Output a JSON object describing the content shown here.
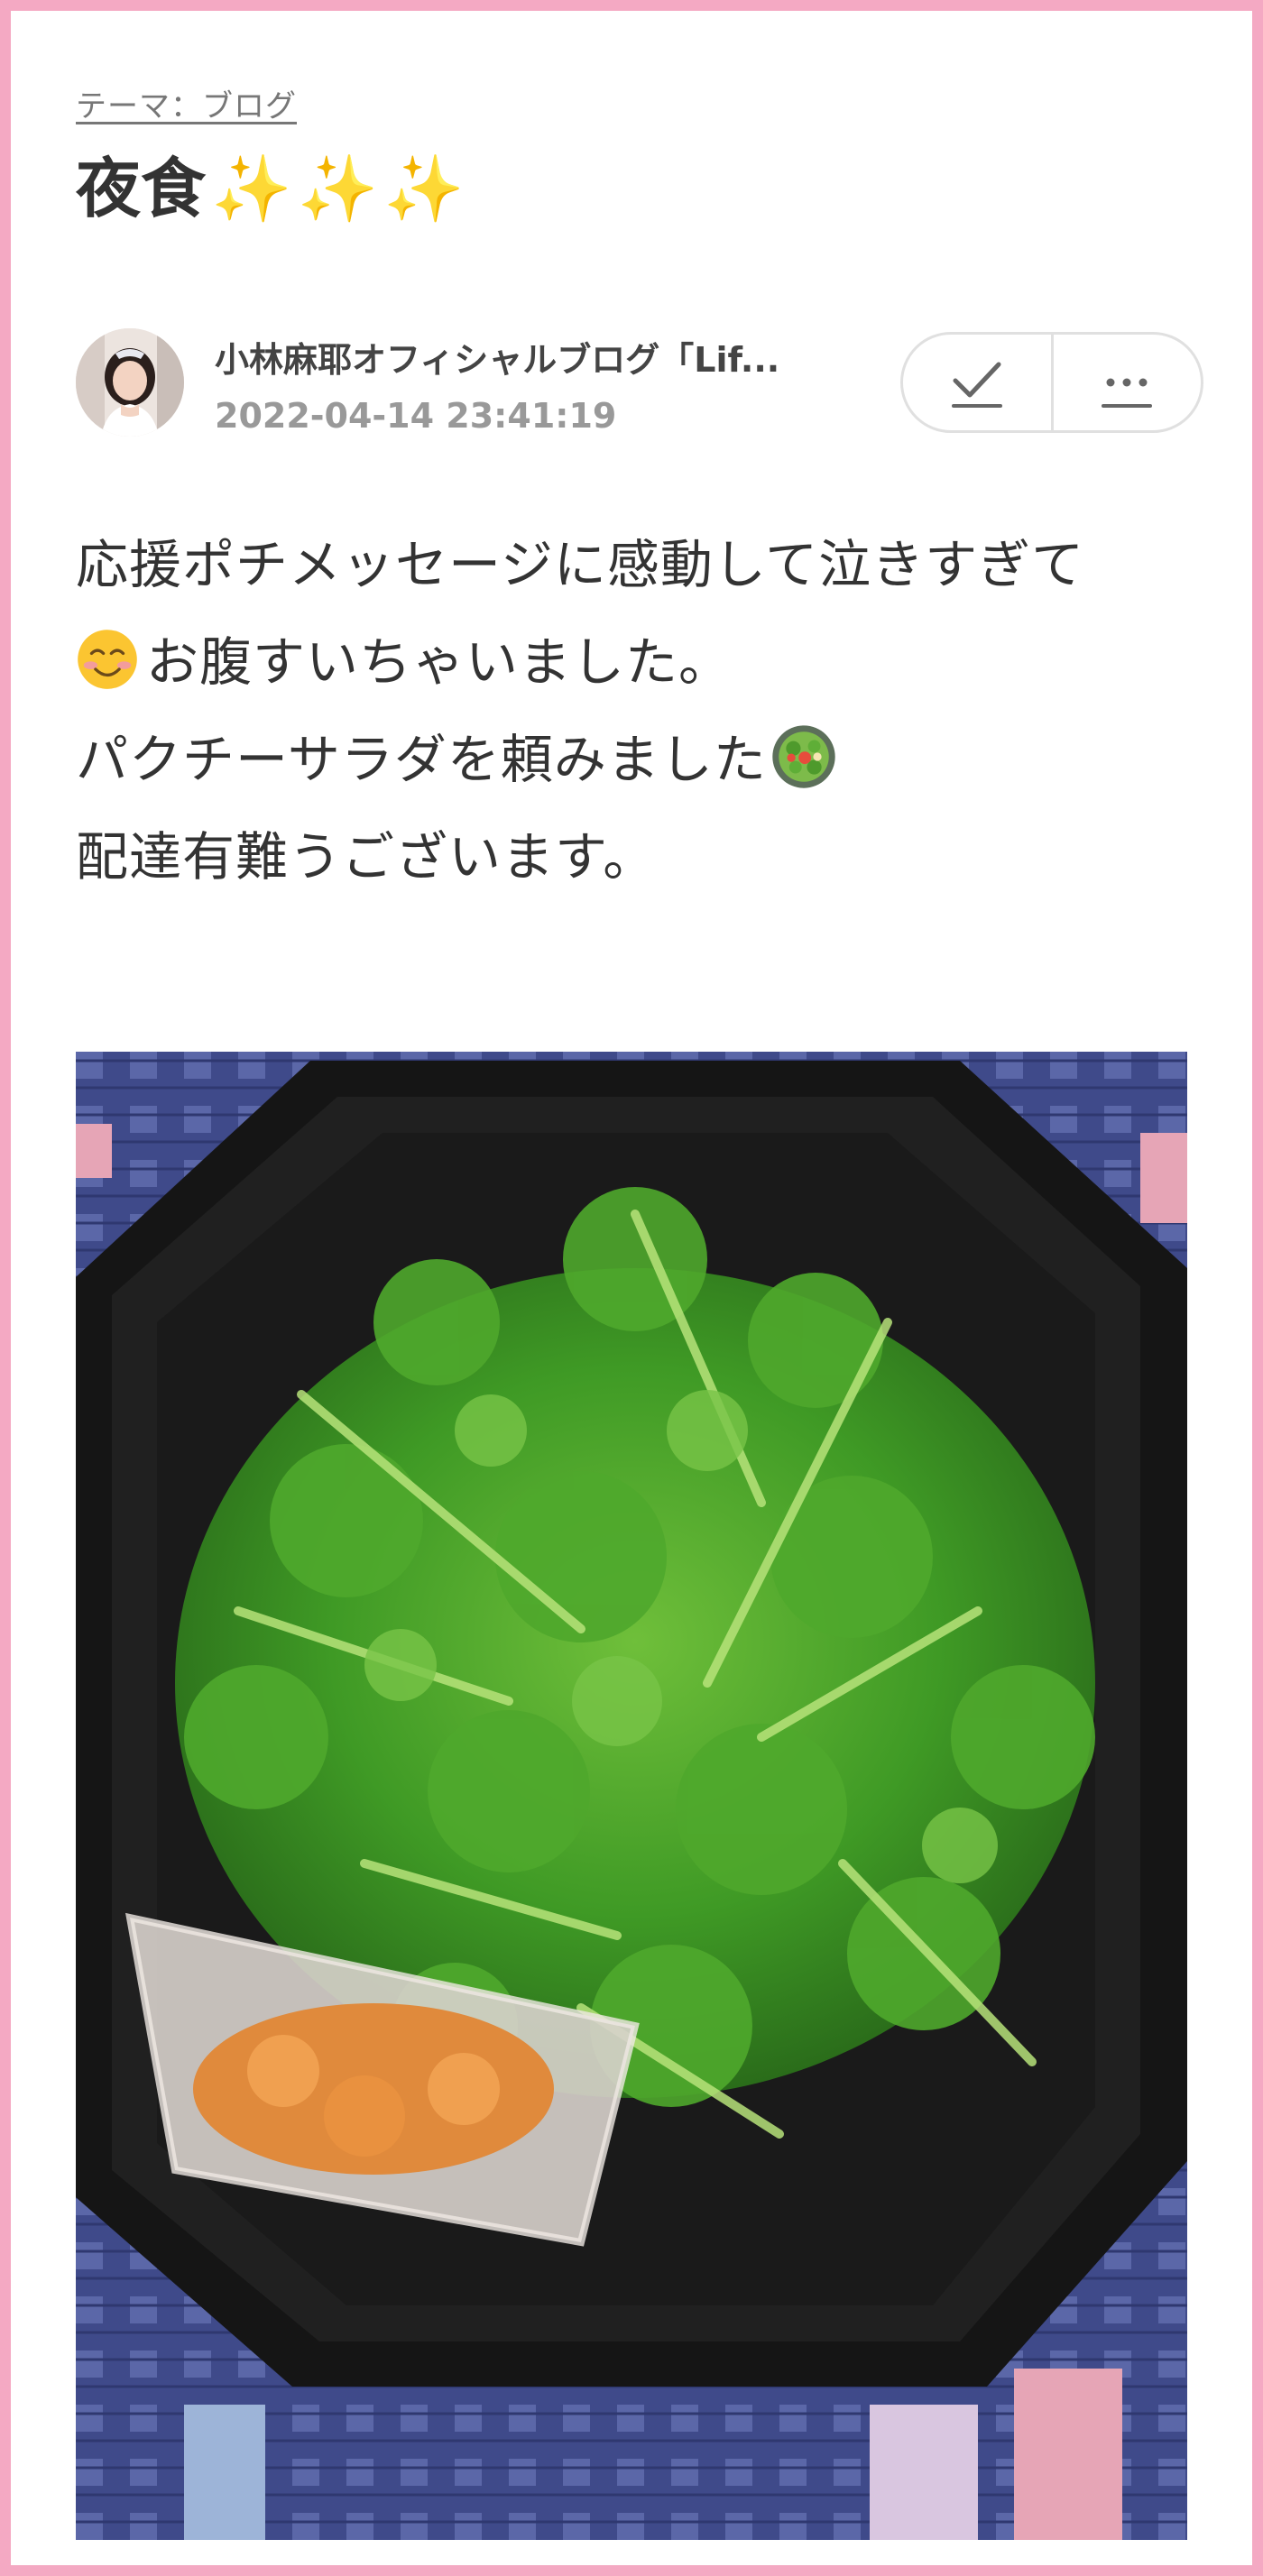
{
  "post": {
    "theme_label": "テーマ：ブログ",
    "title": "夜食",
    "title_emoji": "✨✨✨",
    "author": {
      "name": "小林麻耶オフィシャルブログ「Lif...",
      "date": "2022-04-14 23:41:19"
    },
    "body_lines": [
      "応援ポチメッセージに感動して泣きすぎて",
      "お腹すいちゃいました。",
      "パクチーサラダを頼みました",
      "配達有難うございます。"
    ]
  },
  "icons": {
    "check": "check-icon",
    "more": "more-icon",
    "smile": "smiling-face-emoji",
    "salad": "green-salad-emoji"
  },
  "colors": {
    "frame": "#f4a9c3",
    "date": "#999999",
    "text": "#333333",
    "sparkle": "#f4c542"
  }
}
